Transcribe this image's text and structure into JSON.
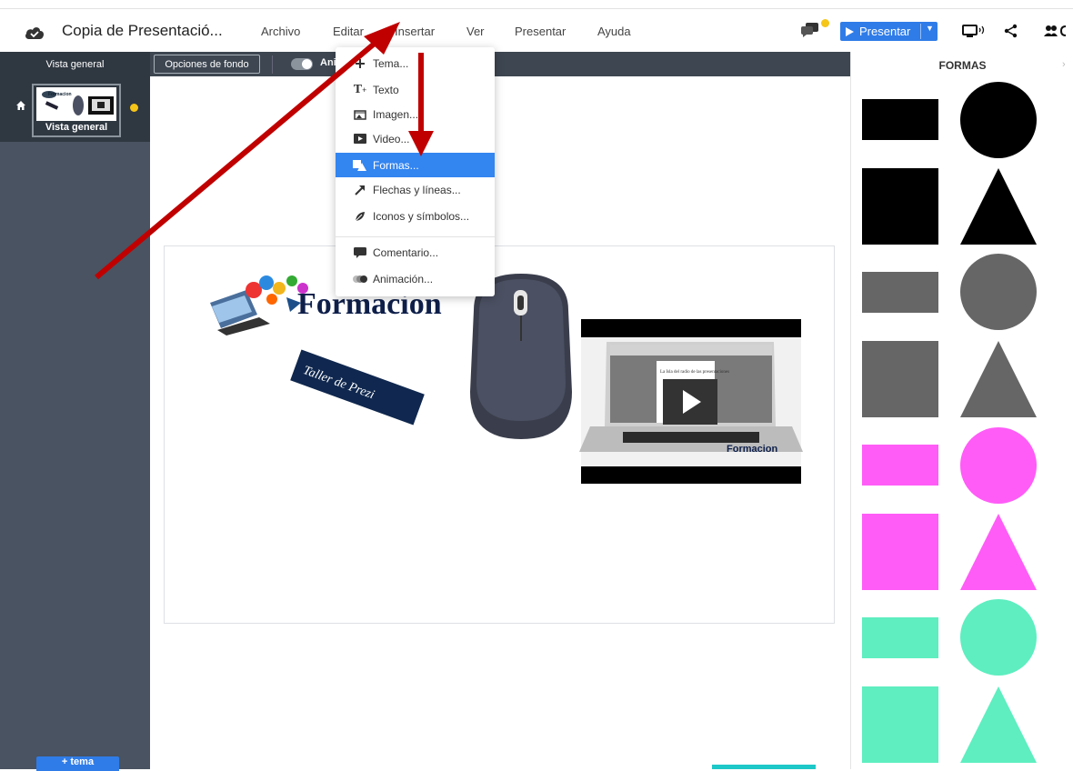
{
  "app": {
    "doc_title": "Copia de Presentació...",
    "menu": [
      "Archivo",
      "Editar",
      "Insertar",
      "Ver",
      "Presentar",
      "Ayuda"
    ],
    "present_label": "Presentar"
  },
  "subbar": {
    "vista_general": "Vista general",
    "opciones_fondo": "Opciones de fondo",
    "animacion_label": "Ani"
  },
  "sidebar": {
    "thumb_label": "Vista general",
    "add_label": "+ tema"
  },
  "insert_menu": {
    "items": [
      "Tema...",
      "Texto",
      "Imagen...",
      "Video...",
      "Formas...",
      "Flechas y líneas...",
      "Iconos y símbolos...",
      "Comentario...",
      "Animación..."
    ],
    "highlighted": "Formas..."
  },
  "slide": {
    "logo_text": "Formacion",
    "banner_text": "Taller de Prezi",
    "video_logo": "Formacion",
    "video_caption": "La Isla del radio de las presentaciones"
  },
  "right_panel": {
    "title": "FORMAS",
    "colors": [
      "#000000",
      "#666666",
      "#ff5cf7",
      "#5eeec0"
    ]
  },
  "colors": {
    "accent": "#2f7ce8",
    "highlight": "#3385f0",
    "annotation_arrow": "#c00000",
    "dark_panel": "#2f3741"
  }
}
